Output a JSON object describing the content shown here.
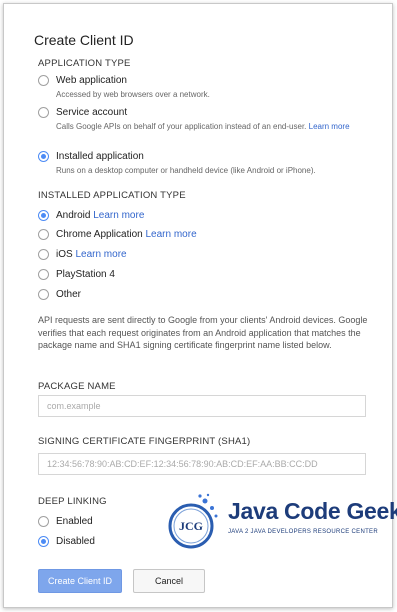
{
  "dialog": {
    "title": "Create Client ID",
    "application_type": {
      "heading": "APPLICATION TYPE",
      "options": [
        {
          "label": "Web application",
          "desc": "Accessed by web browsers over a network.",
          "link": "",
          "checked": false
        },
        {
          "label": "Service account",
          "desc": "Calls Google APIs on behalf of your application instead of an end-user.",
          "link": "Learn more",
          "checked": false
        },
        {
          "label": "Installed application",
          "desc": "Runs on a desktop computer or handheld device (like Android or iPhone).",
          "link": "",
          "checked": true
        }
      ]
    },
    "installed_type": {
      "heading": "INSTALLED APPLICATION TYPE",
      "options": [
        {
          "label": "Android",
          "link": "Learn more",
          "checked": true
        },
        {
          "label": "Chrome Application",
          "link": "Learn more",
          "checked": false
        },
        {
          "label": "iOS",
          "link": "Learn more",
          "checked": false
        },
        {
          "label": "PlayStation 4",
          "link": "",
          "checked": false
        },
        {
          "label": "Other",
          "link": "",
          "checked": false
        }
      ]
    },
    "description": "API requests are sent directly to Google from your clients' Android devices. Google verifies that each request originates from an Android application that matches the package name and SHA1 signing certificate fingerprint name listed below.",
    "package_name": {
      "label": "PACKAGE NAME",
      "placeholder": "com.example",
      "value": ""
    },
    "signing_cert": {
      "label": "SIGNING CERTIFICATE FINGERPRINT (SHA1)",
      "placeholder": "12:34:56:78:90:AB:CD:EF:12:34:56:78:90:AB:CD:EF:AA:BB:CC:DD",
      "value": ""
    },
    "deep_linking": {
      "heading": "DEEP LINKING",
      "options": [
        {
          "label": "Enabled",
          "checked": false
        },
        {
          "label": "Disabled",
          "checked": true
        }
      ]
    },
    "buttons": {
      "create": "Create Client ID",
      "cancel": "Cancel"
    }
  },
  "watermark": {
    "logo_text": "JCG",
    "brand": "Java Code Geeks",
    "tagline": "JAVA 2 JAVA DEVELOPERS RESOURCE CENTER"
  },
  "colors": {
    "accent": "#4c8bf5",
    "link": "#3366cc",
    "primary_button": "#7ea6ec",
    "brand": "#1d3c7a"
  },
  "icons": [
    "radio-unchecked-icon",
    "radio-checked-icon",
    "jcg-logo-icon"
  ]
}
